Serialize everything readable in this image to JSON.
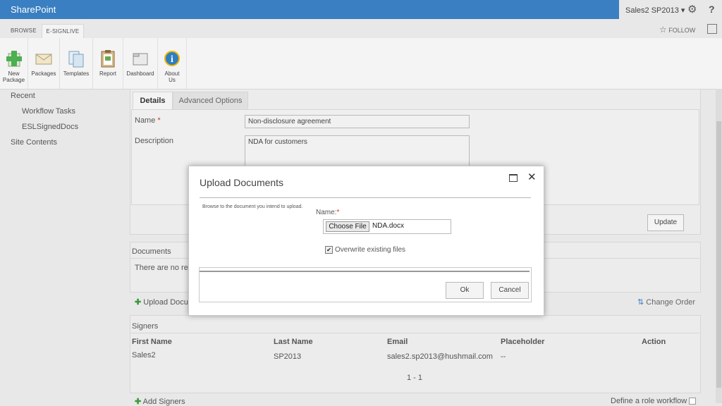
{
  "suite": {
    "brand": "SharePoint",
    "user": "Sales2 SP2013",
    "caret": "▾"
  },
  "ribbon": {
    "tabs": [
      "BROWSE",
      "E-SIGNLIVE"
    ],
    "follow": "FOLLOW",
    "buttons": [
      {
        "label1": "New",
        "label2": "Package",
        "icon": "new-package-icon"
      },
      {
        "label1": "Packages",
        "label2": "",
        "icon": "packages-icon"
      },
      {
        "label1": "Templates",
        "label2": "",
        "icon": "templates-icon"
      },
      {
        "label1": "Report",
        "label2": "",
        "icon": "report-icon"
      },
      {
        "label1": "Dashboard",
        "label2": "",
        "icon": "dashboard-icon"
      },
      {
        "label1": "About",
        "label2": "Us",
        "icon": "about-icon"
      }
    ]
  },
  "nav": {
    "recent": "Recent",
    "items": [
      "Workflow Tasks",
      "ESLSignedDocs"
    ],
    "site_contents": "Site Contents"
  },
  "details": {
    "tabs": [
      "Details",
      "Advanced Options"
    ],
    "name_label": "Name",
    "required": "*",
    "name_value": "Non-disclosure agreement",
    "description_label": "Description",
    "description_value": "NDA for customers",
    "update": "Update"
  },
  "documents": {
    "header": "Documents",
    "empty_text": "There are no reco",
    "upload": "Upload Docum",
    "change_order": "Change Order"
  },
  "signers": {
    "header": "Signers",
    "columns": [
      "First Name",
      "Last Name",
      "Email",
      "Placeholder",
      "Action"
    ],
    "rows": [
      {
        "first": "Sales2",
        "last": "SP2013",
        "email": "sales2.sp2013@hushmail.com",
        "placeholder": "--"
      }
    ],
    "pager": "1 - 1",
    "add": "Add Signers",
    "define_role": "Define a role workflow"
  },
  "dialog": {
    "title": "Upload Documents",
    "hint": "Browse to the document you intend to upload.",
    "name_label": "Name:",
    "required": "*",
    "choose_file": "Choose File",
    "file_name": "NDA.docx",
    "overwrite": "Overwrite existing files",
    "overwrite_checked": true,
    "ok": "Ok",
    "cancel": "Cancel"
  },
  "colors": {
    "suitebar": "#3a7fc1",
    "required": "#c43b1d",
    "add_icon": "#3c9a3c"
  }
}
